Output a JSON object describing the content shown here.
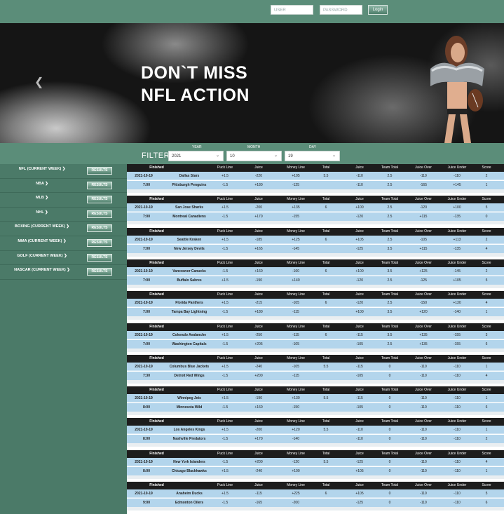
{
  "auth": {
    "user_placeholder": "USER",
    "password_placeholder": "PASSWORD",
    "login_label": "Login"
  },
  "banner": {
    "line1": "DON`T MISS",
    "line2": "NFL ACTION"
  },
  "filter": {
    "label": "FILTER",
    "year": {
      "label": "YEAR",
      "value": "2021"
    },
    "month": {
      "label": "MONTH",
      "value": "10"
    },
    "day": {
      "label": "DAY",
      "value": "19"
    }
  },
  "sidebar": {
    "button_label": "RESULTS",
    "items": [
      "NFL (CURRENT WEEK) ❯",
      "NBA ❯",
      "MLB ❯",
      "NHL ❯",
      "BOXING (CURRENT WEEK) ❯",
      "MMA (CURRENT WEEK) ❯",
      "GOLF (CURRENT WEEK) ❯",
      "NASCAR (CURRENT WEEK) ❯"
    ]
  },
  "columns": [
    "Finished",
    "Puck Line",
    "Juice",
    "Money Line",
    "Total",
    "Juice",
    "Team Total",
    "Juice Over",
    "Juice Under",
    "Score"
  ],
  "games": [
    {
      "date": "2021-10-19",
      "time": "7:00",
      "r1": [
        "Dallas Stars",
        "+1.5",
        "-220",
        "+105",
        "5.5",
        "-110",
        "2.5",
        "-110",
        "-110",
        "2"
      ],
      "r2": [
        "Pittsburgh Penguins",
        "-1.5",
        "+180",
        "-125",
        "",
        "-110",
        "2.5",
        "-165",
        "+145",
        "1"
      ]
    },
    {
      "date": "2021-10-19",
      "time": "7:00",
      "r1": [
        "San Jose Sharks",
        "+1.5",
        "-200",
        "+135",
        "6",
        "+100",
        "2.5",
        "-120",
        "+100",
        "5"
      ],
      "r2": [
        "Montreal Canadiens",
        "-1.5",
        "+170",
        "-155",
        "",
        "-120",
        "2.5",
        "+115",
        "-135",
        "0"
      ]
    },
    {
      "date": "2021-10-19",
      "time": "7:00",
      "r1": [
        "Seattle Kraken",
        "+1.5",
        "-185",
        "+125",
        "6",
        "+105",
        "2.5",
        "-105",
        "+113",
        "2"
      ],
      "r2": [
        "New Jersey Devils",
        "-1.5",
        "+165",
        "-145",
        "",
        "-125",
        "3.5",
        "+115",
        "-135",
        "4"
      ]
    },
    {
      "date": "2021-10-19",
      "time": "7:00",
      "r1": [
        "Vancouver Canucks",
        "-1.5",
        "+160",
        "-160",
        "6",
        "+100",
        "3.5",
        "+125",
        "-145",
        "2"
      ],
      "r2": [
        "Buffalo Sabres",
        "+1.5",
        "-190",
        "+140",
        "",
        "-120",
        "2.5",
        "-125",
        "+105",
        "5"
      ]
    },
    {
      "date": "2021-10-19",
      "time": "7:00",
      "r1": [
        "Florida Panthers",
        "+1.5",
        "-215",
        "-105",
        "6",
        "-120",
        "2.5",
        "-150",
        "+130",
        "4"
      ],
      "r2": [
        "Tampa Bay Lightning",
        "-1.5",
        "+180",
        "-115",
        "",
        "+100",
        "3.5",
        "+120",
        "-140",
        "1"
      ]
    },
    {
      "date": "2021-10-19",
      "time": "7:00",
      "r1": [
        "Colorado Avalanche",
        "+1.5",
        "-250",
        "-115",
        "6",
        "-115",
        "3.5",
        "+135",
        "-155",
        "3"
      ],
      "r2": [
        "Washington Capitals",
        "-1.5",
        "+205",
        "-105",
        "",
        "-105",
        "2.5",
        "+135",
        "-155",
        "6"
      ]
    },
    {
      "date": "2021-10-19",
      "time": "7:30",
      "r1": [
        "Columbus Blue Jackets",
        "+1.5",
        "-240",
        "-105",
        "5.5",
        "-115",
        "0",
        "-110",
        "-110",
        "1"
      ],
      "r2": [
        "Detroit Red Wings",
        "-1.5",
        "+200",
        "-115",
        "",
        "-105",
        "0",
        "-110",
        "-110",
        "4"
      ]
    },
    {
      "date": "2021-10-19",
      "time": "8:00",
      "r1": [
        "Winnipeg Jets",
        "+1.5",
        "-190",
        "+130",
        "5.5",
        "-115",
        "0",
        "-110",
        "-110",
        "1"
      ],
      "r2": [
        "Minnesota Wild",
        "-1.5",
        "+160",
        "-150",
        "",
        "-105",
        "0",
        "-110",
        "-110",
        "6"
      ]
    },
    {
      "date": "2021-10-19",
      "time": "8:00",
      "r1": [
        "Los Angeles Kings",
        "+1.5",
        "-200",
        "+120",
        "5.5",
        "-110",
        "0",
        "-110",
        "-110",
        "1"
      ],
      "r2": [
        "Nashville Predators",
        "-1.5",
        "+170",
        "-140",
        "",
        "-110",
        "0",
        "-110",
        "-110",
        "2"
      ]
    },
    {
      "date": "2021-10-19",
      "time": "8:00",
      "r1": [
        "New York Islanders",
        "-1.5",
        "+200",
        "-120",
        "5.5",
        "-125",
        "0",
        "-110",
        "-110",
        "4"
      ],
      "r2": [
        "Chicago Blackhawks",
        "+1.5",
        "-240",
        "+100",
        "",
        "+105",
        "0",
        "-110",
        "-110",
        "1"
      ]
    },
    {
      "date": "2021-10-19",
      "time": "9:00",
      "r1": [
        "Anaheim Ducks",
        "+1.5",
        "-115",
        "+225",
        "6",
        "+105",
        "0",
        "-110",
        "-110",
        "5"
      ],
      "r2": [
        "Edmonton Oilers",
        "-1.5",
        "-165",
        "-200",
        "",
        "-125",
        "0",
        "-110",
        "-110",
        "6"
      ]
    }
  ]
}
